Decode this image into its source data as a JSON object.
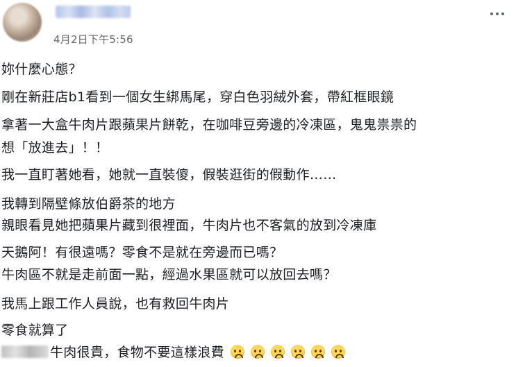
{
  "post": {
    "timestamp": "4月2日下午5:56",
    "lines": [
      "妳什麼心態？",
      "剛在新莊店b1看到一個女生綁馬尾，穿白色羽絨外套，帶紅框眼鏡",
      "拿著一大盒牛肉片跟蘋果片餅乾，在咖啡豆旁邊的冷凍區，鬼鬼祟祟的",
      "想「放進去」！！",
      "我一直盯著她看，她就一直裝傻，假裝逛街的假動作……",
      "我轉到隔壁條放伯爵茶的地方",
      "親眼看見她把蘋果片藏到很裡面，牛肉片也不客氣的放到冷凍庫",
      "天鵝阿！有很遠嗎？零食不是就在旁邊而已嗎？",
      "牛肉區不就是走前面一點，經過水果區就可以放回去嗎？",
      "我馬上跟工作人員說，也有救回牛肉片",
      "零食就算了",
      "牛肉很貴，食物不要這樣浪費"
    ],
    "emoji_icon": "frowning-face-emoji-icon",
    "emoji_count": 6
  }
}
